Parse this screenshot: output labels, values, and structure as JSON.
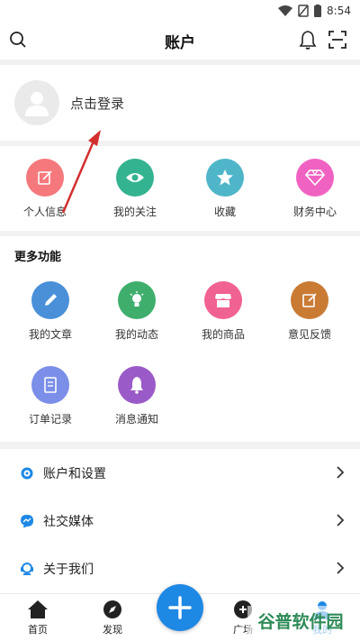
{
  "status_bar": {
    "time": "8:54"
  },
  "header": {
    "title": "账户"
  },
  "login": {
    "text": "点击登录"
  },
  "quick_actions": [
    {
      "label": "个人信息",
      "icon": "edit-icon",
      "color": "#f4787c"
    },
    {
      "label": "我的关注",
      "icon": "eye-icon",
      "color": "#34b391"
    },
    {
      "label": "收藏",
      "icon": "star-icon",
      "color": "#4fb6c9"
    },
    {
      "label": "财务中心",
      "icon": "diamond-icon",
      "color": "#f062c2"
    }
  ],
  "more": {
    "title": "更多功能",
    "items": [
      {
        "label": "我的文章",
        "icon": "pencil-icon",
        "color": "#4a90d9"
      },
      {
        "label": "我的动态",
        "icon": "lightbulb-icon",
        "color": "#3fae6d"
      },
      {
        "label": "我的商品",
        "icon": "store-icon",
        "color": "#f06292"
      },
      {
        "label": "意见反馈",
        "icon": "feedback-icon",
        "color": "#c97b34"
      },
      {
        "label": "订单记录",
        "icon": "document-icon",
        "color": "#7b8ee8"
      },
      {
        "label": "消息通知",
        "icon": "bell-icon",
        "color": "#9a5ac8"
      }
    ]
  },
  "menu": [
    {
      "label": "账户和设置",
      "icon": "gear-icon"
    },
    {
      "label": "社交媒体",
      "icon": "messenger-icon"
    },
    {
      "label": "关于我们",
      "icon": "support-icon"
    }
  ],
  "tabs": [
    {
      "label": "首页",
      "icon": "home-icon"
    },
    {
      "label": "发现",
      "icon": "compass-icon"
    },
    {
      "label": "广场",
      "icon": "square-icon"
    },
    {
      "label": "我的",
      "icon": "person-icon"
    }
  ],
  "watermark": {
    "text": "谷普软件园"
  }
}
